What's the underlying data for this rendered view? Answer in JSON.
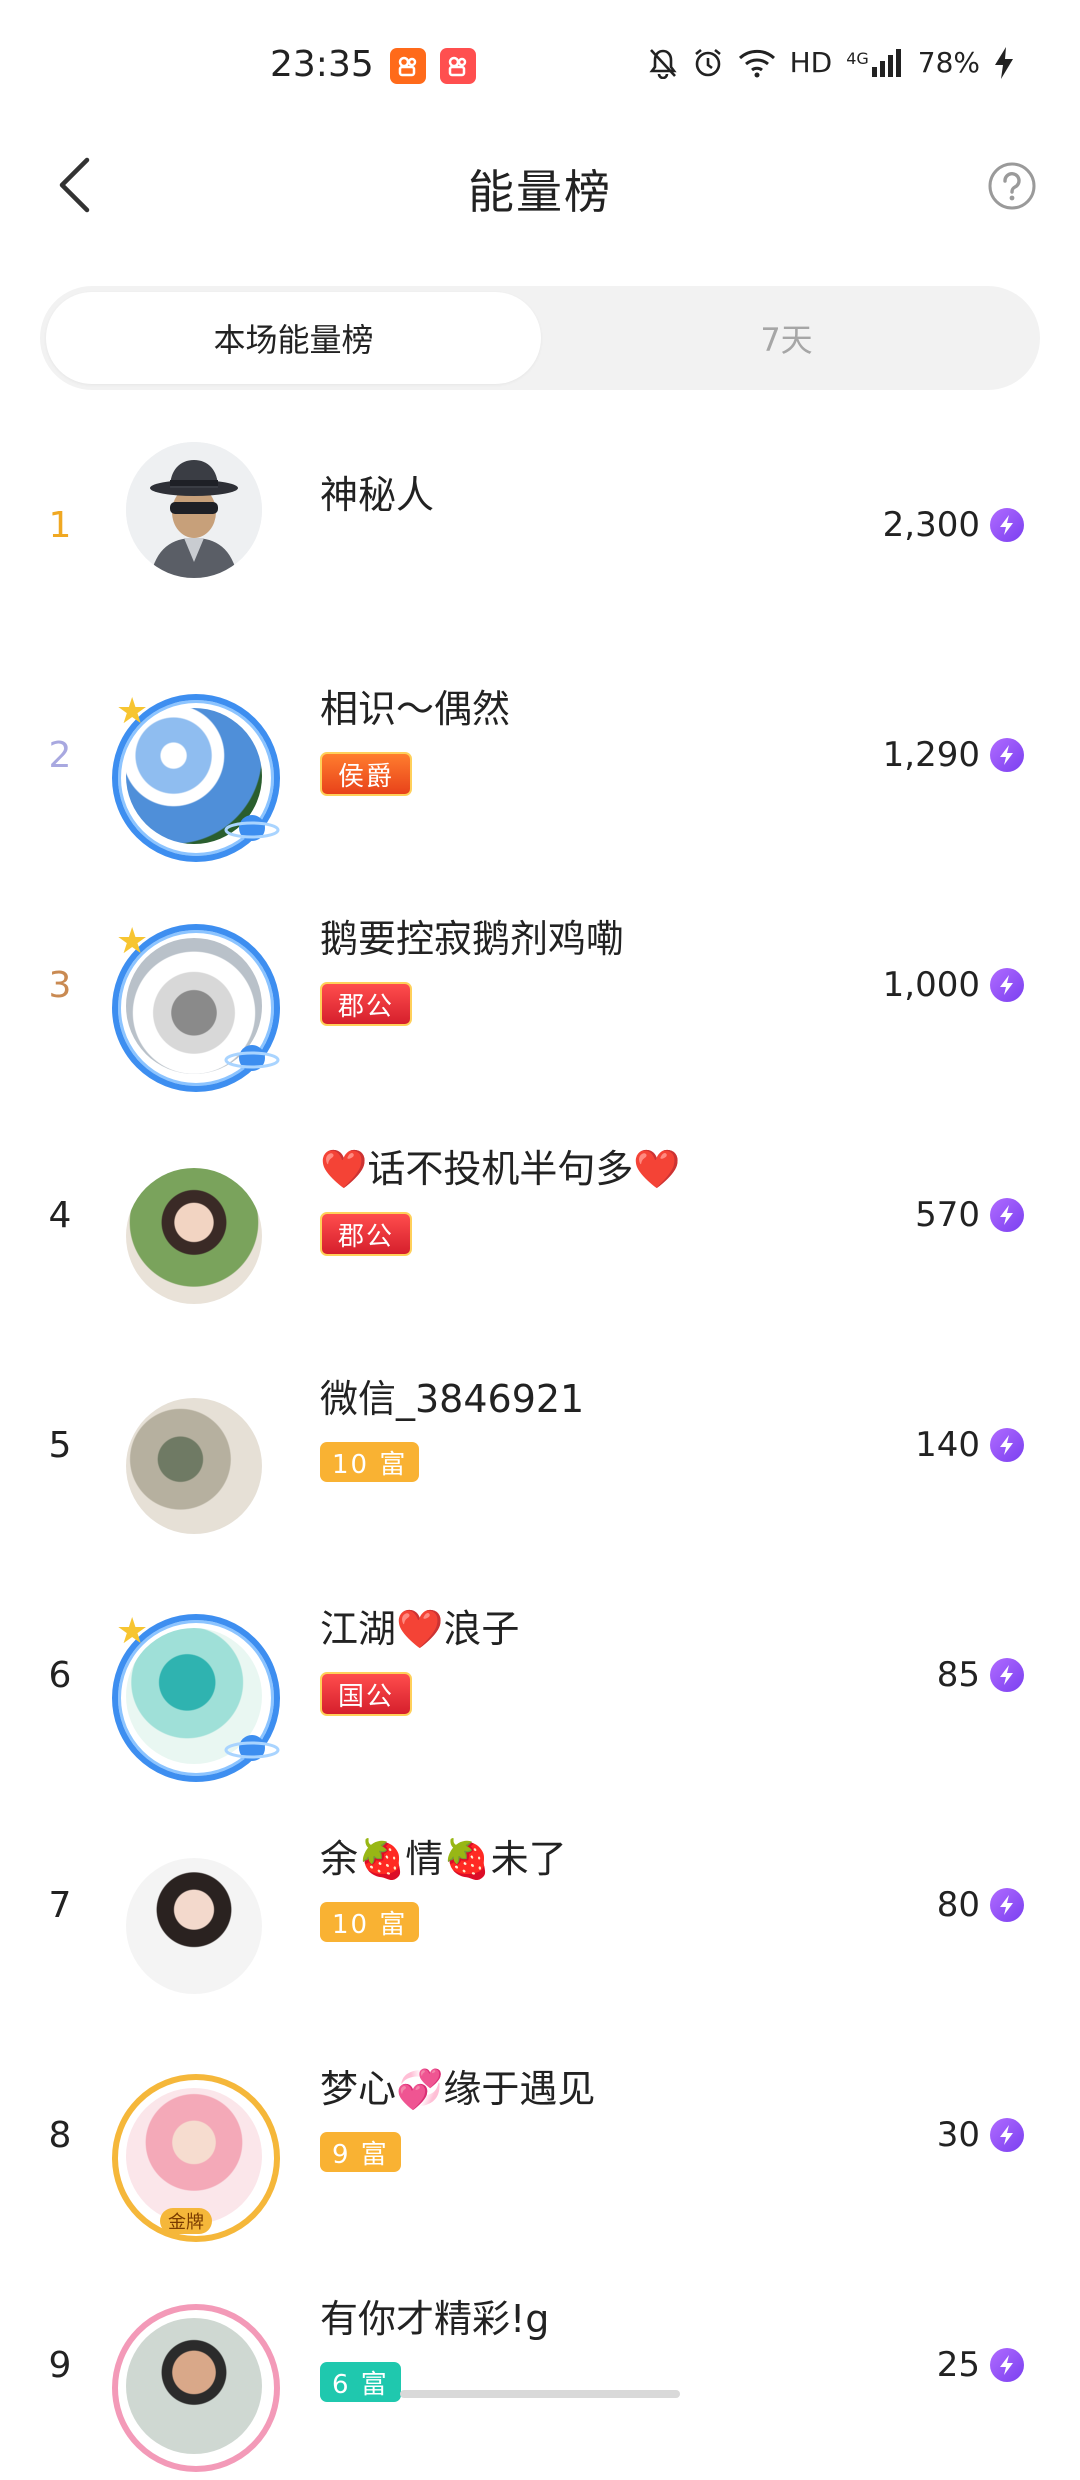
{
  "status_bar": {
    "time": "23:35",
    "network": "HD",
    "signal": "4G",
    "battery": "78%"
  },
  "header": {
    "title": "能量榜",
    "back_icon": "chevron-left-icon",
    "help_icon": "question-circle-icon"
  },
  "tabs": [
    {
      "label": "本场能量榜",
      "active": true
    },
    {
      "label": "7天",
      "active": false
    }
  ],
  "colors": {
    "rank_1": "#f0a822",
    "rank_2": "#a8a8e0",
    "rank_3": "#c98a52",
    "rank_default": "#222222",
    "energy_icon": "#8b4df5"
  },
  "ranking": [
    {
      "rank": "1",
      "name": "神秘人",
      "badge": "",
      "score": "2,300"
    },
    {
      "rank": "2",
      "name": "相识～偶然",
      "badge": "侯爵",
      "score": "1,290"
    },
    {
      "rank": "3",
      "name": "鹅要控寂鹅剂鸡嘞",
      "badge": "郡公",
      "score": "1,000"
    },
    {
      "rank": "4",
      "name": "❤️话不投机半句多❤️",
      "badge": "郡公",
      "score": "570"
    },
    {
      "rank": "5",
      "name": "微信_3846921",
      "badge": "10 富",
      "score": "140"
    },
    {
      "rank": "6",
      "name": "江湖❤️浪子",
      "badge": "国公",
      "score": "85"
    },
    {
      "rank": "7",
      "name": "余🍓情🍓未了",
      "badge": "10 富",
      "score": "80"
    },
    {
      "rank": "8",
      "name": "梦心💞缘于遇见",
      "badge": "9 富",
      "score": "30"
    },
    {
      "rank": "9",
      "name": "有你才精彩!g",
      "badge": "6 富",
      "score": "25"
    }
  ],
  "avatar_frames": {
    "gold_label": "金牌"
  }
}
